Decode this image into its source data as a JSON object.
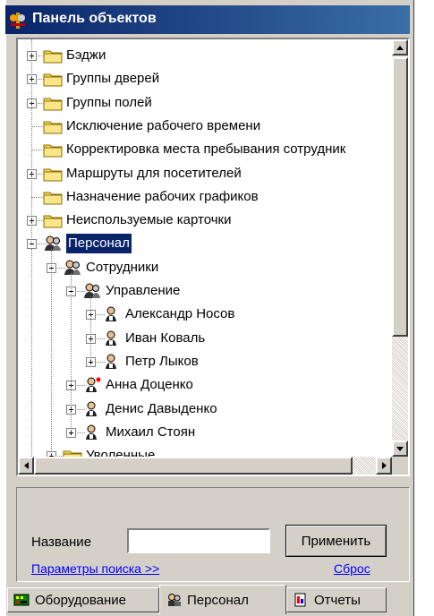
{
  "window": {
    "title": "Панель объектов"
  },
  "tree": {
    "items": [
      {
        "label": "Бэджи",
        "kind": "folder",
        "level": 0,
        "expander": "plus"
      },
      {
        "label": "Группы дверей",
        "kind": "folder",
        "level": 0,
        "expander": "plus"
      },
      {
        "label": "Группы полей",
        "kind": "folder",
        "level": 0,
        "expander": "plus"
      },
      {
        "label": "Исключение рабочего времени",
        "kind": "folder",
        "level": 0,
        "expander": "none"
      },
      {
        "label": "Корректировка места пребывания сотрудник",
        "kind": "folder",
        "level": 0,
        "expander": "none"
      },
      {
        "label": "Маршруты для посетителей",
        "kind": "folder",
        "level": 0,
        "expander": "plus"
      },
      {
        "label": "Назначение рабочих графиков",
        "kind": "folder",
        "level": 0,
        "expander": "none"
      },
      {
        "label": "Неиспользуемые карточки",
        "kind": "folder",
        "level": 0,
        "expander": "plus"
      },
      {
        "label": "Персонал",
        "kind": "group",
        "level": 0,
        "expander": "minus",
        "selected": true
      },
      {
        "label": "Сотрудники",
        "kind": "group",
        "level": 1,
        "expander": "minus"
      },
      {
        "label": "Управление",
        "kind": "group",
        "level": 2,
        "expander": "minus"
      },
      {
        "label": "Александр Носов",
        "kind": "person",
        "level": 3,
        "expander": "plus"
      },
      {
        "label": "Иван Коваль",
        "kind": "person",
        "level": 3,
        "expander": "plus"
      },
      {
        "label": "Петр Лыков",
        "kind": "person",
        "level": 3,
        "expander": "plus"
      },
      {
        "label": "Анна Доценко",
        "kind": "person-red",
        "level": 2,
        "expander": "plus"
      },
      {
        "label": "Денис Давыденко",
        "kind": "person",
        "level": 2,
        "expander": "plus"
      },
      {
        "label": "Михаил Стоян",
        "kind": "person",
        "level": 2,
        "expander": "plus"
      },
      {
        "label": "Уволенные",
        "kind": "folder",
        "level": 1,
        "expander": "plus"
      }
    ]
  },
  "search": {
    "name_label": "Название",
    "name_value": "",
    "apply_label": "Применить",
    "params_link": "Параметры поиска >>",
    "reset_link": "Сброс"
  },
  "tabs": [
    {
      "label": "Оборудование",
      "icon": "equipment-icon",
      "active": false
    },
    {
      "label": "Персонал",
      "icon": "personnel-icon",
      "active": true
    },
    {
      "label": "Отчеты",
      "icon": "reports-icon",
      "active": false
    }
  ],
  "colors": {
    "title_bar": "#0a246a",
    "selection": "#0a246a",
    "folder": "#f7d757",
    "link": "#0000ff"
  }
}
